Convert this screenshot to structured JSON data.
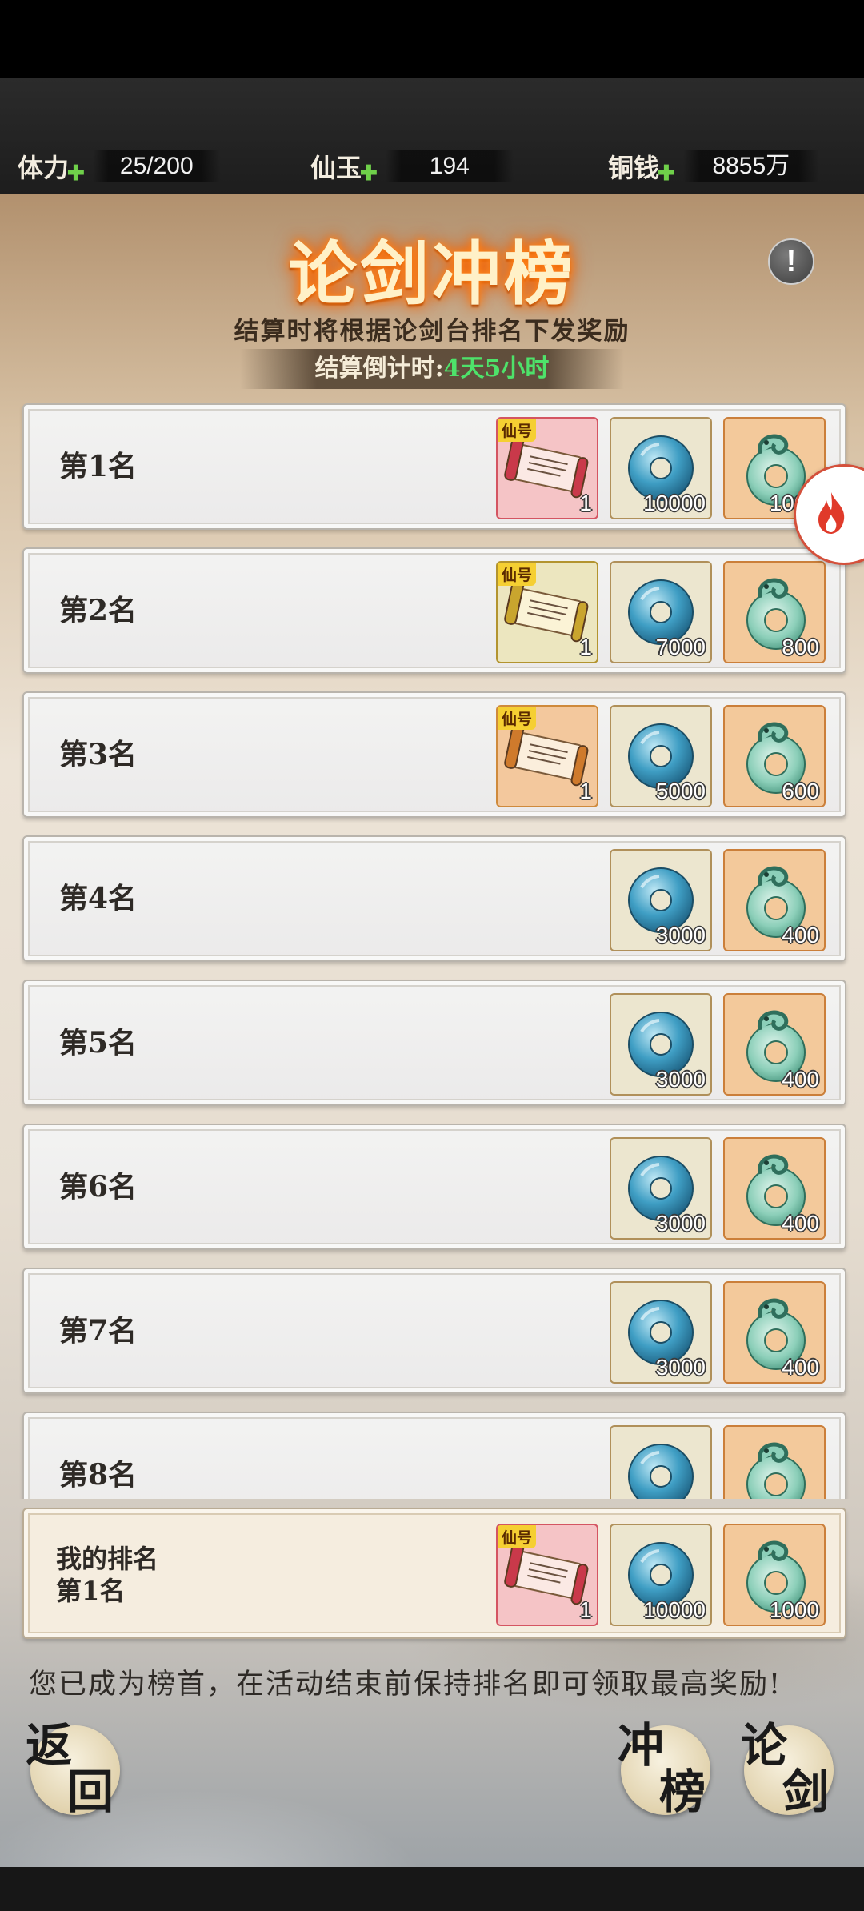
{
  "resources": [
    {
      "label": "体力",
      "value": "25/200"
    },
    {
      "label": "仙玉",
      "value": "194"
    },
    {
      "label": "铜钱",
      "value": "8855万"
    }
  ],
  "header": {
    "title": "论剑冲榜",
    "subtitle": "结算时将根据论剑台排名下发奖励",
    "countdown_label": "结算倒计时:",
    "countdown_value": "4天5小时"
  },
  "tag_label": "仙号",
  "ranks": [
    {
      "label": "第1名",
      "rewards": [
        {
          "icon": "title-scroll-red-icon",
          "qty": "1"
        },
        {
          "icon": "jade-coin-icon",
          "qty": "10000"
        },
        {
          "icon": "jade-dragon-icon",
          "qty": "1000"
        }
      ]
    },
    {
      "label": "第2名",
      "rewards": [
        {
          "icon": "title-scroll-gold-icon",
          "qty": "1"
        },
        {
          "icon": "jade-coin-icon",
          "qty": "7000"
        },
        {
          "icon": "jade-dragon-icon",
          "qty": "800"
        }
      ]
    },
    {
      "label": "第3名",
      "rewards": [
        {
          "icon": "title-scroll-orange-icon",
          "qty": "1"
        },
        {
          "icon": "jade-coin-icon",
          "qty": "5000"
        },
        {
          "icon": "jade-dragon-icon",
          "qty": "600"
        }
      ]
    },
    {
      "label": "第4名",
      "rewards": [
        {
          "icon": "jade-coin-icon",
          "qty": "3000"
        },
        {
          "icon": "jade-dragon-icon",
          "qty": "400"
        }
      ]
    },
    {
      "label": "第5名",
      "rewards": [
        {
          "icon": "jade-coin-icon",
          "qty": "3000"
        },
        {
          "icon": "jade-dragon-icon",
          "qty": "400"
        }
      ]
    },
    {
      "label": "第6名",
      "rewards": [
        {
          "icon": "jade-coin-icon",
          "qty": "3000"
        },
        {
          "icon": "jade-dragon-icon",
          "qty": "400"
        }
      ]
    },
    {
      "label": "第7名",
      "rewards": [
        {
          "icon": "jade-coin-icon",
          "qty": "3000"
        },
        {
          "icon": "jade-dragon-icon",
          "qty": "400"
        }
      ]
    },
    {
      "label": "第8名",
      "rewards": [
        {
          "icon": "jade-coin-icon",
          "qty": ""
        },
        {
          "icon": "jade-dragon-icon",
          "qty": ""
        }
      ]
    }
  ],
  "my_rank": {
    "title": "我的排名",
    "rank": "第1名",
    "rewards": [
      {
        "icon": "title-scroll-red-icon",
        "qty": "1"
      },
      {
        "icon": "jade-coin-icon",
        "qty": "10000"
      },
      {
        "icon": "jade-dragon-icon",
        "qty": "1000"
      }
    ]
  },
  "notice": "您已成为榜首，在活动结束前保持排名即可领取最高奖励!",
  "buttons": {
    "back": [
      "返",
      "回"
    ],
    "rank": [
      "冲",
      "榜"
    ],
    "duel": [
      "论",
      "剑"
    ]
  },
  "colors": {
    "countdown": "#4ee26a",
    "title_glow": "#ff6a00"
  }
}
